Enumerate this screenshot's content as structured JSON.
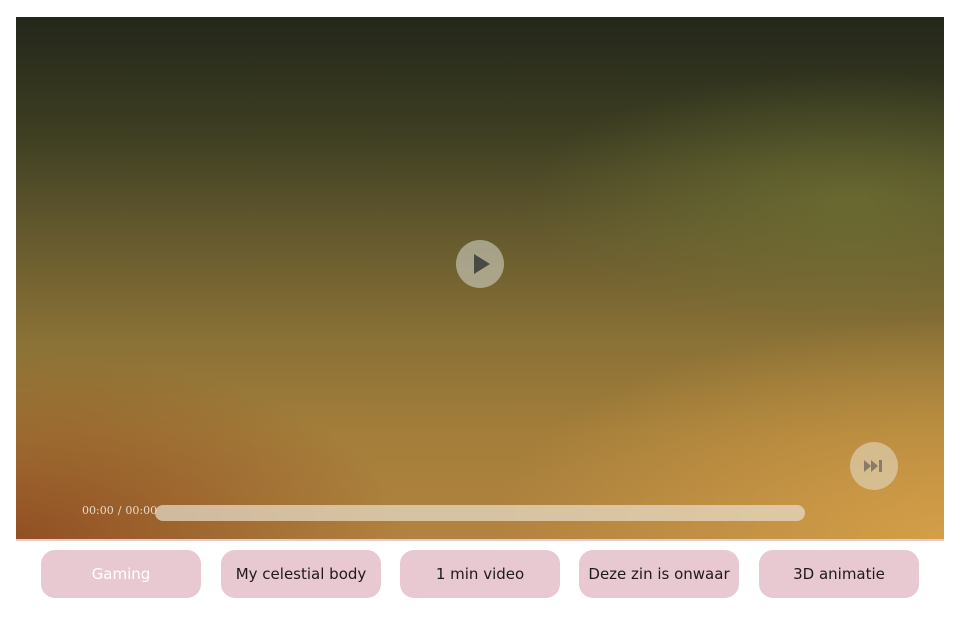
{
  "player": {
    "current_time": "00:00",
    "separator": "/",
    "duration": "00:00",
    "progress_fraction": 0,
    "play_icon": "play-icon",
    "skip_icon": "skip-next-icon"
  },
  "chips": [
    {
      "label": "Gaming",
      "active": true
    },
    {
      "label": "My celestial body",
      "active": false
    },
    {
      "label": "1 min video",
      "active": false
    },
    {
      "label": "Deze zin is onwaar",
      "active": false
    },
    {
      "label": "3D animatie",
      "active": false
    }
  ],
  "colors": {
    "chip_background": "#e8c9d1",
    "chip_active_text": "#ffffff",
    "chip_text": "#1f1a1a"
  }
}
